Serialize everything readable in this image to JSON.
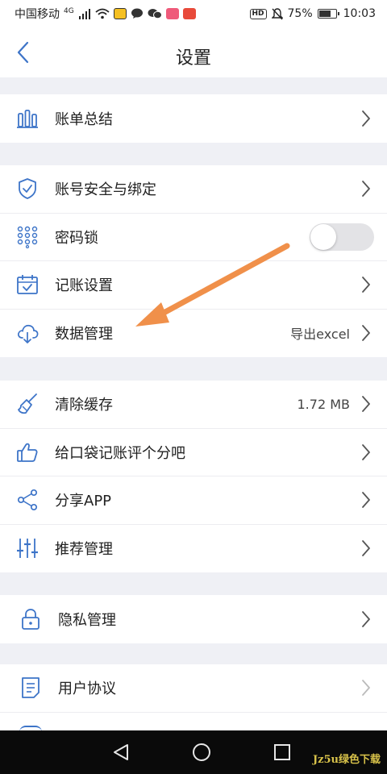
{
  "status_bar": {
    "carrier": "中国移动",
    "network": "4G",
    "hd_badge": "HD",
    "battery_percent": "75%",
    "battery_level": 0.75,
    "time": "10:03"
  },
  "header": {
    "title": "设置",
    "back_icon": "chevron-left-icon"
  },
  "groups": [
    {
      "items": [
        {
          "label": "账单总结",
          "icon": "bar-chart-icon",
          "value": "",
          "control": "chevron"
        }
      ]
    },
    {
      "items": [
        {
          "label": "账号安全与绑定",
          "icon": "shield-check-icon",
          "value": "",
          "control": "chevron"
        },
        {
          "label": "密码锁",
          "icon": "keypad-icon",
          "value": "",
          "control": "toggle",
          "toggle_on": false
        },
        {
          "label": "记账设置",
          "icon": "calendar-check-icon",
          "value": "",
          "control": "chevron"
        },
        {
          "label": "数据管理",
          "icon": "cloud-download-icon",
          "value": "导出excel",
          "control": "chevron"
        }
      ]
    },
    {
      "items": [
        {
          "label": "清除缓存",
          "icon": "broom-icon",
          "value": "1.72 MB",
          "control": "chevron"
        },
        {
          "label": "给口袋记账评个分吧",
          "icon": "thumbs-up-icon",
          "value": "",
          "control": "chevron"
        },
        {
          "label": "分享APP",
          "icon": "share-icon",
          "value": "",
          "control": "chevron"
        },
        {
          "label": "推荐管理",
          "icon": "sliders-icon",
          "value": "",
          "control": "chevron"
        }
      ]
    },
    {
      "items": [
        {
          "label": "隐私管理",
          "icon": "lock-icon",
          "value": "",
          "control": "chevron"
        }
      ]
    },
    {
      "items": [
        {
          "label": "用户协议",
          "icon": "document-icon",
          "value": "",
          "control": "chevron-light"
        }
      ]
    }
  ],
  "annotation": {
    "icon": "arrow-annotation",
    "color": "#f0904a"
  },
  "colors": {
    "accent": "#3d74c8",
    "chevron": "#555555",
    "background": "#eff0f5"
  },
  "navigation_bar": {
    "back": "triangle-back-icon",
    "home": "circle-home-icon",
    "recents": "square-recents-icon"
  },
  "watermark": "Jz5u绿色下载"
}
